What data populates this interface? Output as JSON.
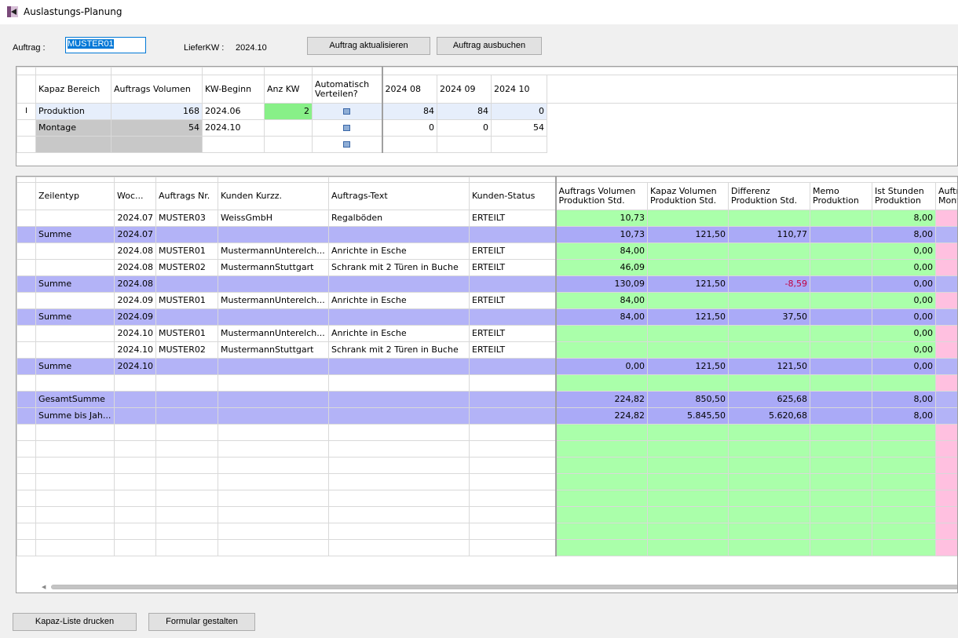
{
  "window": {
    "title": "Auslastungs-Planung"
  },
  "form": {
    "auftrag_label": "Auftrag :",
    "auftrag_value": "MUSTER01",
    "lieferkw_label": "LieferKW :",
    "lieferkw_value": "2024.10",
    "btn_update": "Auftrag aktualisieren",
    "btn_book": "Auftrag ausbuchen"
  },
  "top_grid": {
    "headers": [
      "Kapaz Bereich",
      "Auftrags Volumen",
      "KW-Beginn",
      "Anz KW",
      "Automatisch Verteilen?",
      "2024 08",
      "2024 09",
      "2024 10"
    ],
    "rows": [
      {
        "bereich": "Produktion",
        "volumen": "168",
        "beginn": "2024.06",
        "anz": "2",
        "w1": "84",
        "w2": "84",
        "w3": "0"
      },
      {
        "bereich": "Montage",
        "volumen": "54",
        "beginn": "2024.10",
        "anz": "",
        "w1": "0",
        "w2": "0",
        "w3": "54"
      }
    ],
    "row_marker": "I"
  },
  "bottom_grid": {
    "headers": {
      "zeilentyp": "Zeilentyp",
      "woche": "Woc...",
      "nr": "Auftrags Nr.",
      "kunde": "Kunden Kurzz.",
      "text": "Auftrags-Text",
      "status": "Kunden-Status",
      "av": "Auftrags Volumen Produktion Std.",
      "kv": "Kapaz Volumen Produktion Std.",
      "diff": "Differenz Produktion Std.",
      "memo": "Memo Produktion",
      "ist": "Ist Stunden Produktion",
      "mont": "Auftr Mont"
    },
    "rows": [
      {
        "type": "",
        "woche": "2024.07",
        "nr": "MUSTER03",
        "kunde": "WeissGmbH",
        "text": "Regalböden",
        "status": "ERTEILT",
        "av": "10,73",
        "kv": "",
        "diff": "",
        "memo": "",
        "ist": "8,00"
      },
      {
        "type": "Summe",
        "woche": "2024.07",
        "nr": "",
        "kunde": "",
        "text": "",
        "status": "",
        "av": "10,73",
        "kv": "121,50",
        "diff": "110,77",
        "memo": "",
        "ist": "8,00"
      },
      {
        "type": "",
        "woche": "2024.08",
        "nr": "MUSTER01",
        "kunde": "MustermannUnterelch...",
        "text": "Anrichte in Esche",
        "status": "ERTEILT",
        "av": "84,00",
        "kv": "",
        "diff": "",
        "memo": "",
        "ist": "0,00"
      },
      {
        "type": "",
        "woche": "2024.08",
        "nr": "MUSTER02",
        "kunde": "MustermannStuttgart",
        "text": "Schrank mit 2 Türen in Buche",
        "status": "ERTEILT",
        "av": "46,09",
        "kv": "",
        "diff": "",
        "memo": "",
        "ist": "0,00"
      },
      {
        "type": "Summe",
        "woche": "2024.08",
        "nr": "",
        "kunde": "",
        "text": "",
        "status": "",
        "av": "130,09",
        "kv": "121,50",
        "diff": "-8,59",
        "memo": "",
        "ist": "0,00"
      },
      {
        "type": "",
        "woche": "2024.09",
        "nr": "MUSTER01",
        "kunde": "MustermannUnterelch...",
        "text": "Anrichte in Esche",
        "status": "ERTEILT",
        "av": "84,00",
        "kv": "",
        "diff": "",
        "memo": "",
        "ist": "0,00"
      },
      {
        "type": "Summe",
        "woche": "2024.09",
        "nr": "",
        "kunde": "",
        "text": "",
        "status": "",
        "av": "84,00",
        "kv": "121,50",
        "diff": "37,50",
        "memo": "",
        "ist": "0,00"
      },
      {
        "type": "",
        "woche": "2024.10",
        "nr": "MUSTER01",
        "kunde": "MustermannUnterelch...",
        "text": "Anrichte in Esche",
        "status": "ERTEILT",
        "av": "",
        "kv": "",
        "diff": "",
        "memo": "",
        "ist": "0,00"
      },
      {
        "type": "",
        "woche": "2024.10",
        "nr": "MUSTER02",
        "kunde": "MustermannStuttgart",
        "text": "Schrank mit 2 Türen in Buche",
        "status": "ERTEILT",
        "av": "",
        "kv": "",
        "diff": "",
        "memo": "",
        "ist": "0,00"
      },
      {
        "type": "Summe",
        "woche": "2024.10",
        "nr": "",
        "kunde": "",
        "text": "",
        "status": "",
        "av": "0,00",
        "kv": "121,50",
        "diff": "121,50",
        "memo": "",
        "ist": "0,00"
      },
      {
        "type": "",
        "woche": "",
        "nr": "",
        "kunde": "",
        "text": "",
        "status": "",
        "av": "",
        "kv": "",
        "diff": "",
        "memo": "",
        "ist": ""
      },
      {
        "type": "GesamtSumme",
        "woche": "",
        "nr": "",
        "kunde": "",
        "text": "",
        "status": "",
        "av": "224,82",
        "kv": "850,50",
        "diff": "625,68",
        "memo": "",
        "ist": "8,00"
      },
      {
        "type": "Summe bis Jah...",
        "woche": "",
        "nr": "",
        "kunde": "",
        "text": "",
        "status": "",
        "av": "224,82",
        "kv": "5.845,50",
        "diff": "5.620,68",
        "memo": "",
        "ist": "8,00"
      }
    ]
  },
  "footer": {
    "btn_print": "Kapaz-Liste drucken",
    "btn_design": "Formular gestalten"
  },
  "colors": {
    "accent": "#0078d7",
    "green": "#aaffaa",
    "pink": "#ffc0e0",
    "summary": "#b3b3f7",
    "negative": "#c00040"
  }
}
